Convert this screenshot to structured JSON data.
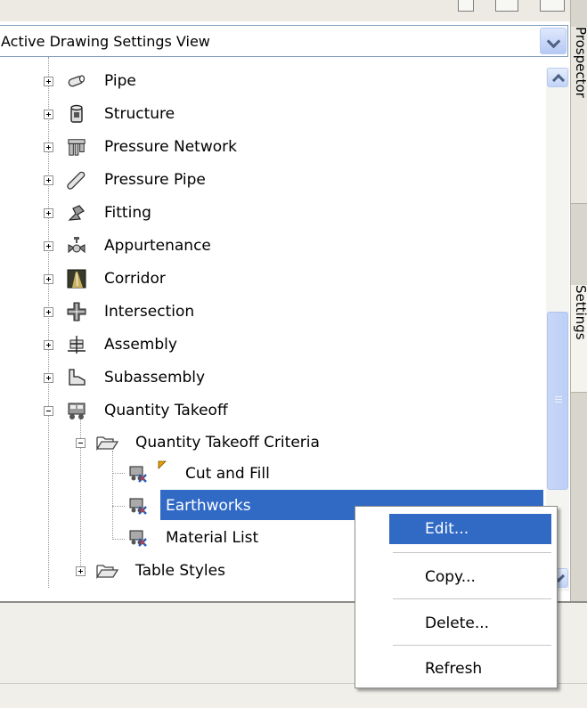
{
  "view_select": {
    "value": "Active Drawing Settings View"
  },
  "tree": {
    "items": [
      {
        "label": "Pipe",
        "icon": "pipe-icon"
      },
      {
        "label": "Structure",
        "icon": "structure-icon"
      },
      {
        "label": "Pressure Network",
        "icon": "pressure-network-icon"
      },
      {
        "label": "Pressure Pipe",
        "icon": "pressure-pipe-icon"
      },
      {
        "label": "Fitting",
        "icon": "fitting-icon"
      },
      {
        "label": "Appurtenance",
        "icon": "appurtenance-icon"
      },
      {
        "label": "Corridor",
        "icon": "corridor-icon"
      },
      {
        "label": "Intersection",
        "icon": "intersection-icon"
      },
      {
        "label": "Assembly",
        "icon": "assembly-icon"
      },
      {
        "label": "Subassembly",
        "icon": "subassembly-icon"
      },
      {
        "label": "Quantity Takeoff",
        "icon": "quantity-takeoff-icon"
      }
    ],
    "qto_criteria_label": "Quantity Takeoff Criteria",
    "criteria_children": [
      {
        "label": "Cut and Fill",
        "icon": "criteria-icon"
      },
      {
        "label": "Earthworks",
        "icon": "criteria-icon",
        "selected": true
      },
      {
        "label": "Material List",
        "icon": "criteria-icon"
      }
    ],
    "table_styles_label": "Table Styles"
  },
  "side_tabs": {
    "prospector": "Prospector",
    "settings": "Settings"
  },
  "context_menu": {
    "items": [
      {
        "label": "Edit...",
        "active": true
      },
      {
        "label": "Copy..."
      },
      {
        "label": "Delete..."
      },
      {
        "label": "Refresh"
      }
    ]
  },
  "colors": {
    "selection": "#316ac5",
    "accent_scroll": "#c8d7f8"
  }
}
